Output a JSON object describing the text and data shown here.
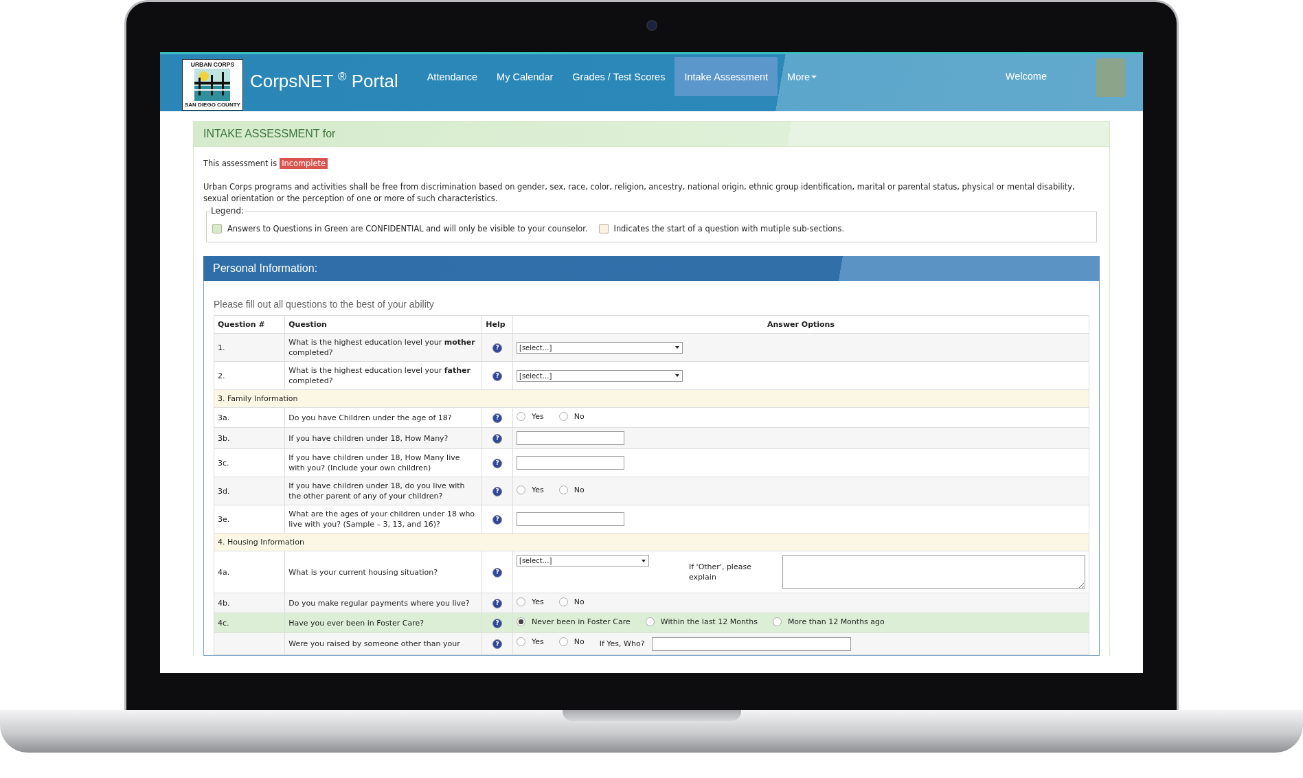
{
  "header": {
    "logo": {
      "top_text": "URBAN CORPS",
      "bottom_text": "SAN DIEGO COUNTY"
    },
    "brand": "CorpsNET $^{®}$ Portal",
    "nav": [
      {
        "label": "Attendance",
        "selected": false,
        "dropdown": false
      },
      {
        "label": "My Calendar",
        "selected": false,
        "dropdown": false
      },
      {
        "label": "Grades / Test Scores",
        "selected": false,
        "dropdown": false
      },
      {
        "label": "Intake Assessment",
        "selected": true,
        "dropdown": false
      },
      {
        "label": "More",
        "selected": false,
        "dropdown": true
      }
    ],
    "welcome": "Welcome"
  },
  "page_title": "INTAKE ASSESSMENT for",
  "status": {
    "label": "This assessment is",
    "badge": "Incomplete"
  },
  "notice": "Urban Corps programs and activities shall be free from discrimination based on gender, sex, race, color, religion, ancestry, national origin, ethnic group identification, marital or parental status, physical or mental disability, sexual orientation or the perception of one or more of such characteristics.",
  "legend": {
    "title": "Legend:",
    "items": [
      {
        "color": "#d6ecc9",
        "text": "Answers to Questions in Green are CONFIDENTIAL and will only be visible to your counselor."
      },
      {
        "color": "#fcf2df",
        "text": "Indicates the start of a question with mutiple sub-sections."
      }
    ]
  },
  "section": {
    "title": "Personal Information:",
    "instructions": "Please fill out all questions to the best of your ability",
    "table": {
      "columns": [
        "Question #",
        "Question",
        "Help",
        "Answer Options"
      ],
      "rows": [
        {
          "kind": "question",
          "number": "1.",
          "question": "What is the highest education level your **mother** completed?",
          "help": "?",
          "confidential": false,
          "answer": {
            "kind": "select",
            "value": "[select…]"
          }
        },
        {
          "kind": "question",
          "number": "2.",
          "question": "What is the highest education level your **father** completed?",
          "help": "?",
          "confidential": false,
          "answer": {
            "kind": "select",
            "value": "[select…]"
          }
        },
        {
          "kind": "section",
          "label": "3. Family Information"
        },
        {
          "kind": "question",
          "number": "3a.",
          "question": "Do you have Children under the age of 18?",
          "help": "?",
          "confidential": false,
          "answer": {
            "kind": "radio",
            "options": [
              {
                "label": "Yes",
                "selected": false
              },
              {
                "label": "No",
                "selected": false
              }
            ]
          }
        },
        {
          "kind": "question",
          "number": "3b.",
          "question": "If you have children under 18, How Many?",
          "help": "?",
          "confidential": false,
          "answer": {
            "kind": "text"
          }
        },
        {
          "kind": "question",
          "number": "3c.",
          "question": "If you have children under 18, How Many live with you? (Include your own children)",
          "help": "?",
          "confidential": false,
          "answer": {
            "kind": "text"
          }
        },
        {
          "kind": "question",
          "number": "3d.",
          "question": "If you have children under 18, do you live with the other parent of any of your children?",
          "help": "?",
          "confidential": false,
          "answer": {
            "kind": "radio",
            "options": [
              {
                "label": "Yes",
                "selected": false
              },
              {
                "label": "No",
                "selected": false
              }
            ]
          }
        },
        {
          "kind": "question",
          "number": "3e.",
          "question": "What are the ages of your children under 18 who live with you? (Sample – 3, 13, and 16)?",
          "help": "?",
          "confidential": false,
          "answer": {
            "kind": "text"
          }
        },
        {
          "kind": "section",
          "label": "4. Housing Information"
        },
        {
          "kind": "question",
          "number": "4a.",
          "question": "What is your current housing situation?",
          "help": "?",
          "confidential": false,
          "answer": {
            "kind": "select_other",
            "value": "[select…]",
            "other_label": "If 'Other', please explain"
          }
        },
        {
          "kind": "question",
          "number": "4b.",
          "question": "Do you make regular payments where you live?",
          "help": "?",
          "confidential": false,
          "answer": {
            "kind": "radio",
            "options": [
              {
                "label": "Yes",
                "selected": false
              },
              {
                "label": "No",
                "selected": false
              }
            ]
          }
        },
        {
          "kind": "question",
          "number": "4c.",
          "question": "Have you ever been in Foster Care?",
          "help": "?",
          "confidential": true,
          "answer": {
            "kind": "radio",
            "options": [
              {
                "label": "Never been in Foster Care",
                "selected": true
              },
              {
                "label": "Within the last 12 Months",
                "selected": false
              },
              {
                "label": "More than 12 Months ago",
                "selected": false
              }
            ]
          }
        },
        {
          "kind": "question",
          "question": "Were you raised by someone other than your",
          "help": "?",
          "confidential": false,
          "answer": {
            "kind": "radio_other",
            "options": [
              {
                "label": "Yes",
                "selected": false
              },
              {
                "label": "No",
                "selected": false
              }
            ],
            "other_label": "If Yes, Who?"
          }
        }
      ]
    }
  }
}
